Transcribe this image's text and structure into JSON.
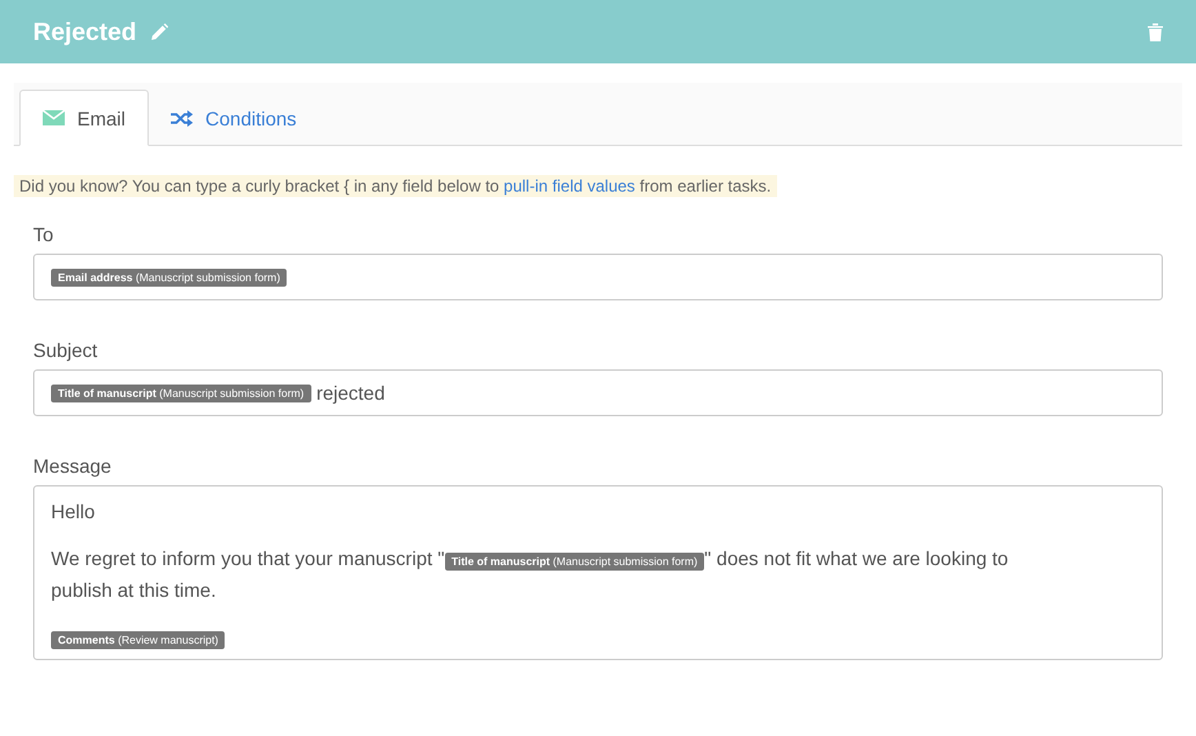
{
  "header": {
    "title": "Rejected"
  },
  "tabs": [
    {
      "label": "Email",
      "kind": "email",
      "selected": true
    },
    {
      "label": "Conditions",
      "kind": "shuffle",
      "selected": false
    }
  ],
  "tip": {
    "before": "Did you know? You can type a curly bracket { in any field below to",
    "link": "pull-in field values",
    "after": "from earlier tasks."
  },
  "fields": [
    {
      "label": "To",
      "segments": [
        {
          "kind": "token",
          "text": "**Email address** (Manuscript submission form)"
        }
      ]
    },
    {
      "label": "Subject",
      "segments": [
        {
          "kind": "token",
          "text": "**Title of manuscript** (Manuscript submission form)"
        },
        {
          "kind": "text",
          "text": "rejected"
        }
      ]
    }
  ],
  "message": {
    "label": "Message",
    "paragraphs": [
      [
        [
          {
            "kind": "text",
            "text": "Hello"
          }
        ]
      ],
      [
        [
          {
            "kind": "text",
            "text": "We regret to inform you that your manuscript \""
          },
          {
            "kind": "token",
            "text": "**Title of manuscript** (Manuscript submission form)"
          },
          {
            "kind": "text",
            "text": "\" does not fit what we are looking to"
          }
        ],
        [
          {
            "kind": "text",
            "text": "publish at this time."
          }
        ]
      ],
      [
        [
          {
            "kind": "token",
            "text": "**Comments** (Review manuscript)"
          }
        ]
      ]
    ]
  }
}
